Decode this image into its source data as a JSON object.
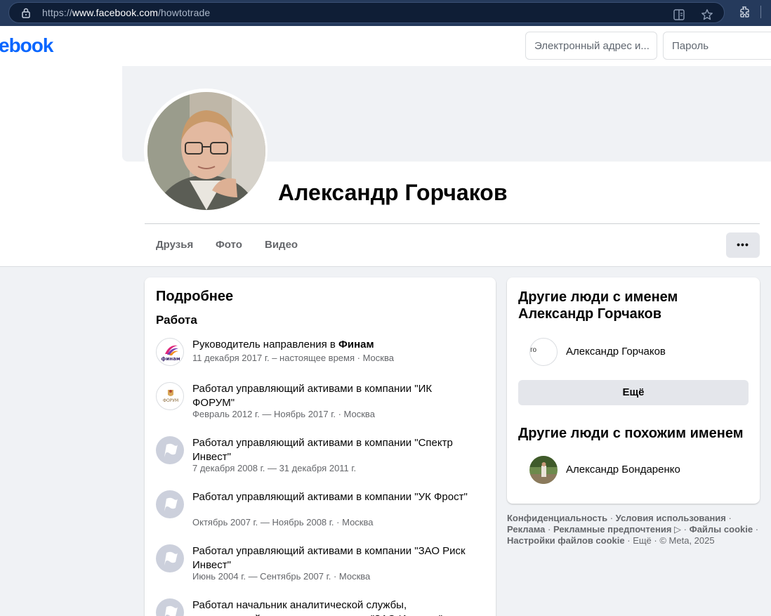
{
  "browser": {
    "url_prefix": "https://",
    "url_domain": "www.facebook.com",
    "url_path": "/howtotrade"
  },
  "topbar": {
    "logo_text": "ebook",
    "email_placeholder": "Электронный адрес и...",
    "password_placeholder": "Пароль"
  },
  "profile": {
    "name": "Александр Горчаков",
    "tabs": [
      "Друзья",
      "Фото",
      "Видео"
    ],
    "more_label": "•••"
  },
  "intro": {
    "title": "Подробнее",
    "work_heading": "Работа",
    "work": [
      {
        "title": "Руководитель направления в ",
        "company": "Финам",
        "sub": "11 декабря 2017 г. – настоящее время · Москва",
        "icon": "finam-logo"
      },
      {
        "title": "Работал управляющий активами в компании \"ИК ФОРУМ\"",
        "sub": "Февраль 2012 г. — Ноябрь 2017 г. · Москва",
        "icon": "forum-logo"
      },
      {
        "title": "Работал управляющий активами в компании \"Спектр Инвест\"",
        "sub": "7 декабря 2008 г. — 31 декабря 2011 г.",
        "icon": "flag-icon"
      },
      {
        "title": "Работал управляющий активами в компании \"УК Фрост\"",
        "sub": "Октябрь 2007 г. — Ноябрь 2008 г. · Москва",
        "icon": "flag-icon"
      },
      {
        "title": "Работал управляющий активами в компании \"ЗАО Риск Инвест\"",
        "sub": "Июнь 2004 г. — Сентябрь 2007 г. · Москва",
        "icon": "flag-icon"
      },
      {
        "title": "Работал начальник аналитической службы, управляющий активами в компании \"ЗАО Интраст\"",
        "sub": "",
        "icon": "flag-icon"
      }
    ]
  },
  "others": {
    "title": "Другие люди с именем Александр Горчаков",
    "people": [
      {
        "name": "Александр Горчаков",
        "avatar_text": "то"
      }
    ],
    "more_button": "Ещё",
    "similar_title": "Другие люди с похожим именем",
    "similar": [
      {
        "name": "Александр Бондаренко"
      }
    ]
  },
  "footer": {
    "privacy": "Конфиденциальность",
    "terms": "Условия использования",
    "ads": "Реклама",
    "ad_choices": "Рекламные предпочтения ▷",
    "cookies": "Файлы cookie",
    "cookie_settings": "Настройки файлов cookie",
    "more": "Ещё",
    "copyright": "© Meta, 2025"
  },
  "colors": {
    "brand": "#0866ff",
    "chrome": "#253a5c",
    "page_bg": "#f0f2f5"
  }
}
